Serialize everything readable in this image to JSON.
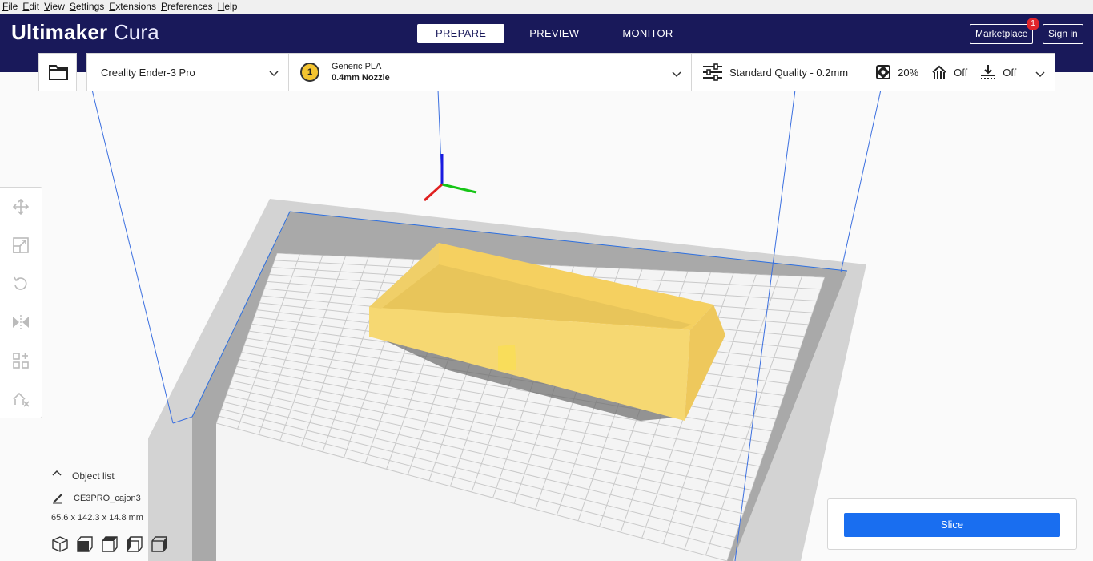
{
  "menu": [
    {
      "first": "F",
      "rest": "ile"
    },
    {
      "first": "E",
      "rest": "dit"
    },
    {
      "first": "V",
      "rest": "iew"
    },
    {
      "first": "S",
      "rest": "ettings"
    },
    {
      "first": "E",
      "rest": "xtensions"
    },
    {
      "first": "P",
      "rest": "references"
    },
    {
      "first": "H",
      "rest": "elp"
    }
  ],
  "header": {
    "logo_bold": "Ultimaker",
    "logo_light": "Cura",
    "tabs": [
      "PREPARE",
      "PREVIEW",
      "MONITOR"
    ],
    "active_tab": "PREPARE",
    "marketplace_label": "Marketplace",
    "marketplace_badge": "1",
    "signin_label": "Sign in"
  },
  "toolbar": {
    "open_icon": "folder-icon",
    "printer": "Creality Ender-3 Pro",
    "extruder_number": "1",
    "material": "Generic PLA",
    "nozzle": "0.4mm Nozzle",
    "profile": "Standard Quality - 0.2mm",
    "infill": "20%",
    "support": "Off",
    "adhesion": "Off"
  },
  "tools": [
    "move-icon",
    "scale-icon",
    "rotate-icon",
    "mirror-icon",
    "per-model-settings-icon",
    "support-blocker-icon"
  ],
  "objects": {
    "header": "Object list",
    "name": "CE3PRO_cajon3",
    "dimensions": "65.6 x 142.3 x 14.8 mm"
  },
  "view_buttons": [
    "3d-view-icon",
    "front-view-icon",
    "top-view-icon",
    "left-view-icon",
    "right-view-icon"
  ],
  "slice": {
    "label": "Slice"
  },
  "colors": {
    "header_bg": "#19195a",
    "accent": "#196ef0",
    "model": "#f7d768",
    "badge": "#e0252b"
  }
}
